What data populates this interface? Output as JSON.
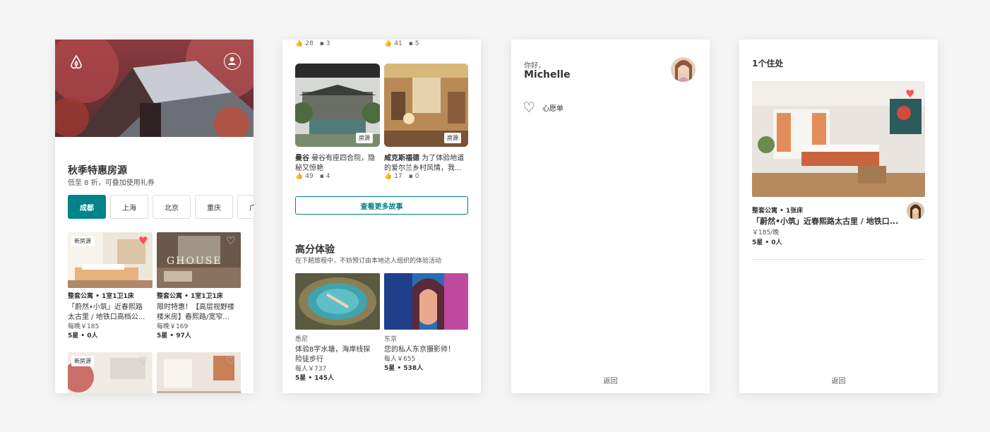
{
  "colors": {
    "teal": "#008489",
    "heart": "#ff4f5a",
    "bg": "#f5f5f5"
  },
  "panel1": {
    "logo_icon": "airbnb-logo-icon",
    "profile_icon": "user-icon",
    "section_title": "秋季特惠房源",
    "section_subtitle": "低至 8 折，可叠加使用礼券",
    "cities": [
      "成都",
      "上海",
      "北京",
      "重庆",
      "广"
    ],
    "listings": [
      {
        "badge": "新房源",
        "type": "整套公寓 • 1室1卫1床",
        "title1": "「蔚然•小筑」近春熙路",
        "title2": "太古里 / 地铁口高档公...",
        "price": "每晚￥185",
        "rating": "5星 • 0人"
      },
      {
        "badge": "",
        "type": "整套公寓 • 1室1卫1床",
        "title1": "限时特惠！【高层视野楼",
        "title2": "楼米房】春熙路/宽窄...",
        "price": "每晚￥169",
        "rating": "5星 • 97人"
      },
      {
        "badge": "新房源"
      },
      {
        "badge": ""
      }
    ]
  },
  "panel2": {
    "top_stats": [
      {
        "likes": "28",
        "comments": "3"
      },
      {
        "likes": "41",
        "comments": "5"
      }
    ],
    "stories": [
      {
        "tag": "房源",
        "place": "曼谷",
        "desc1": "曼谷有座四合院，隐",
        "desc2": "秘又惊艳",
        "likes": "49",
        "comments": "4"
      },
      {
        "tag": "房源",
        "place": "威克斯福德",
        "desc1": "为了体验地道",
        "desc2": "的爱尔兰乡村风情，我...",
        "likes": "17",
        "comments": "0"
      }
    ],
    "more_button": "查看更多故事",
    "exp_title": "高分体验",
    "exp_subtitle": "在下趟旅程中，不妨预订由本地达人组织的体验活动",
    "experiences": [
      {
        "city": "悉尼",
        "title1": "体验8字水塘，海岸线探",
        "title2": "险徒步行",
        "price": "每人￥737",
        "rating": "5星 • 145人"
      },
      {
        "city": "东京",
        "title1": "您的私人东京摄影师！",
        "title2": "",
        "price": "每人￥655",
        "rating": "5星 • 538人"
      }
    ]
  },
  "panel3": {
    "greeting": "你好，",
    "name": "Michelle",
    "wishlist": "心愿单",
    "back": "返回"
  },
  "panel4": {
    "title": "1个住处",
    "type": "整套公寓 • 1张床",
    "listing_title": "「蔚然•小筑」近春熙路太古里 / 地铁口...",
    "price": "￥185/晚",
    "rating": "5星 • 0人",
    "back": "返回"
  }
}
